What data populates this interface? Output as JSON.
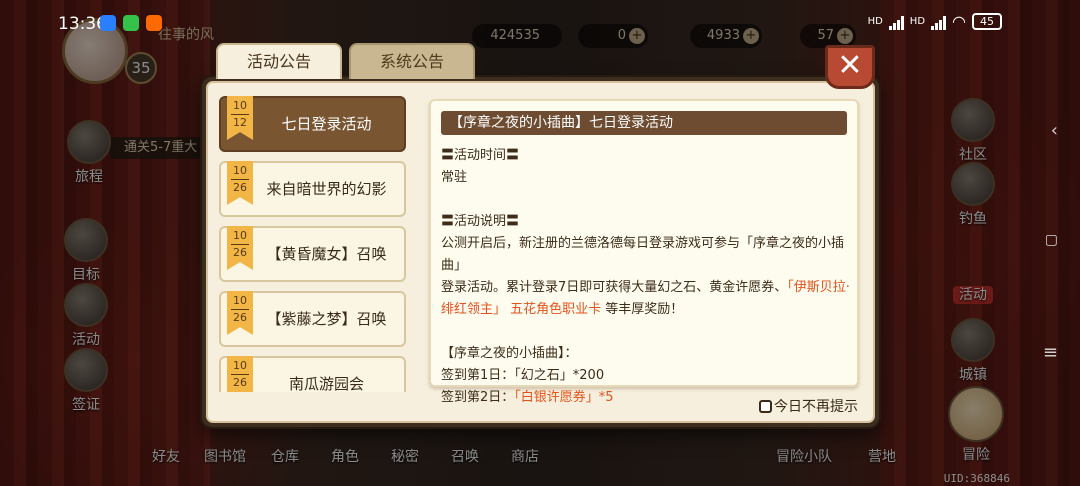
{
  "status_bar": {
    "time": "13:36",
    "signal_1": "HD",
    "signal_2": "HD",
    "battery": "45"
  },
  "player": {
    "name": "往事的风",
    "level": "35",
    "stage": "通关5-7重大"
  },
  "resources": [
    {
      "value": "424535"
    },
    {
      "value": "0"
    },
    {
      "value": "4933"
    },
    {
      "value": "57"
    }
  ],
  "side_menu": [
    "旅程",
    "目标",
    "活动",
    "签证"
  ],
  "right_menu": [
    "社区",
    "钓鱼",
    "活动",
    "城镇",
    "冒险"
  ],
  "bottom_menu": [
    "好友",
    "图书馆",
    "仓库",
    "角色",
    "秘密",
    "召唤",
    "商店",
    "冒险小队",
    "营地"
  ],
  "uid": "UID:368846",
  "dialog": {
    "tabs": {
      "active": "活动公告",
      "inactive": "系统公告"
    },
    "close_label": "✕",
    "events": [
      {
        "month": "10",
        "day": "12",
        "title": "七日登录活动",
        "active": true
      },
      {
        "month": "10",
        "day": "26",
        "title": "来自暗世界的幻影",
        "active": false
      },
      {
        "month": "10",
        "day": "26",
        "title": "【黄昏魔女】召唤",
        "active": false
      },
      {
        "month": "10",
        "day": "26",
        "title": "【紫藤之梦】召唤",
        "active": false
      },
      {
        "month": "10",
        "day": "26",
        "title": "南瓜游园会",
        "active": false
      }
    ],
    "content": {
      "title": "【序章之夜的小插曲】七日登录活动",
      "time_header": "〓活动时间〓",
      "time_value": "常驻",
      "desc_header": "〓活动说明〓",
      "desc_line1": "公测开启后，新注册的兰德洛德每日登录游戏可参与「序章之夜的小插曲」",
      "desc_line2_a": "登录活动。累计登录7日即可获得大量幻之石、黄金许愿券、",
      "desc_line2_hl": "「伊斯贝拉·",
      "desc_line3_hl": "绯红领主」 五花角色职业卡",
      "desc_line3_b": " 等丰厚奖励！",
      "reward_header": "【序章之夜的小插曲】：",
      "day1": "签到第1日：「幻之石」*200",
      "day2_a": "签到第2日：",
      "day2_hl": "「白银许愿券」*5"
    },
    "noshow_label": "今日不再提示"
  }
}
